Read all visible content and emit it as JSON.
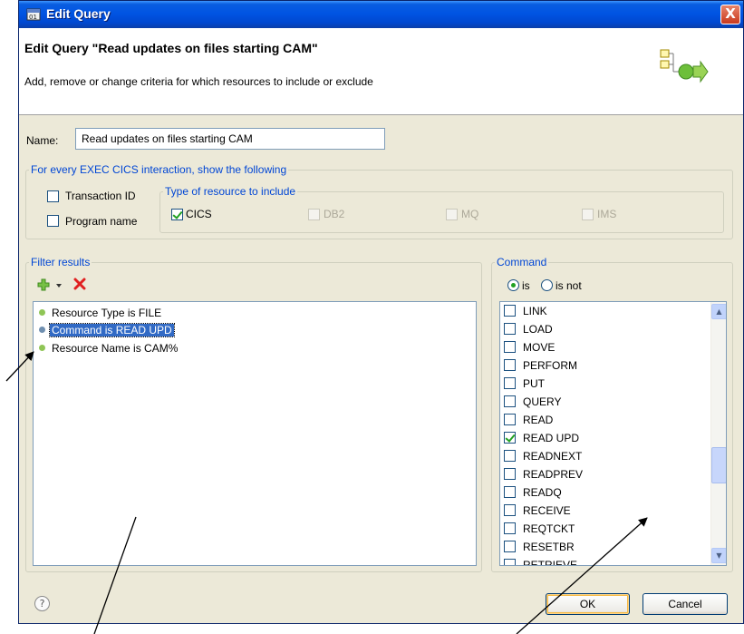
{
  "window": {
    "title": "Edit Query",
    "close_glyph": "X"
  },
  "banner": {
    "title": "Edit Query \"Read updates on files starting CAM\"",
    "description": "Add, remove or change criteria for which resources to include or exclude",
    "image_icon": "query-wizard-icon"
  },
  "name": {
    "label": "Name:",
    "value": "Read updates on files starting CAM"
  },
  "interaction_group": {
    "legend": "For every EXEC CICS interaction, show the following",
    "transaction_id": {
      "label": "Transaction ID",
      "checked": false
    },
    "program_name": {
      "label": "Program name",
      "checked": false
    },
    "resource_type_group": {
      "legend": "Type of resource to include",
      "items": [
        {
          "label": "CICS",
          "checked": true,
          "enabled": true
        },
        {
          "label": "DB2",
          "checked": false,
          "enabled": false
        },
        {
          "label": "MQ",
          "checked": false,
          "enabled": false
        },
        {
          "label": "IMS",
          "checked": false,
          "enabled": false
        }
      ]
    }
  },
  "filter_results": {
    "legend": "Filter results",
    "toolbar": {
      "add_icon": "plus-icon",
      "dropdown_icon": "dropdown-arrow-icon",
      "delete_icon": "red-x-icon"
    },
    "items": [
      {
        "text": "Resource Type is FILE",
        "selected": false,
        "dot_color": "#8fc556"
      },
      {
        "text": "Command is READ UPD",
        "selected": true,
        "dot_color": "#6f8fb0"
      },
      {
        "text": "Resource Name is CAM%",
        "selected": false,
        "dot_color": "#8fc556"
      }
    ]
  },
  "command": {
    "legend": "Command",
    "radio_is": {
      "label": "is",
      "selected": true
    },
    "radio_is_not": {
      "label": "is not",
      "selected": false
    },
    "items": [
      {
        "label": "LINK",
        "checked": false
      },
      {
        "label": "LOAD",
        "checked": false
      },
      {
        "label": "MOVE",
        "checked": false
      },
      {
        "label": "PERFORM",
        "checked": false
      },
      {
        "label": "PUT",
        "checked": false
      },
      {
        "label": "QUERY",
        "checked": false
      },
      {
        "label": "READ",
        "checked": false
      },
      {
        "label": "READ UPD",
        "checked": true
      },
      {
        "label": "READNEXT",
        "checked": false
      },
      {
        "label": "READPREV",
        "checked": false
      },
      {
        "label": "READQ",
        "checked": false
      },
      {
        "label": "RECEIVE",
        "checked": false
      },
      {
        "label": "REQTCKT",
        "checked": false
      },
      {
        "label": "RESETBR",
        "checked": false
      },
      {
        "label": "RETRIEVE",
        "checked": false
      }
    ]
  },
  "buttons": {
    "ok": "OK",
    "cancel": "Cancel",
    "help_glyph": "?"
  },
  "colors": {
    "title_bar": "#0054e3",
    "group_legend": "#0046d5",
    "selection": "#316ac5",
    "check_mark": "#21a121"
  }
}
